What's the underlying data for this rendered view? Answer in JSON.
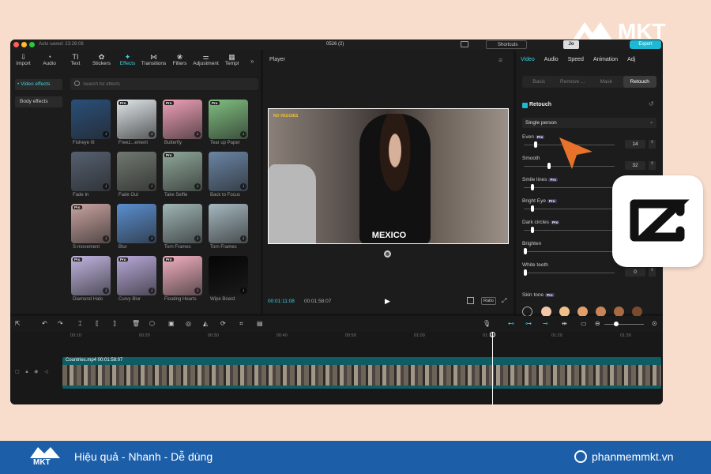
{
  "titlebar": {
    "autosave": "Auto saved: 23:28:08",
    "project": "0526 (2)",
    "shortcuts": "Shortcuts",
    "user": "Jo",
    "export": "Export"
  },
  "left_tabs": [
    {
      "label": "Import",
      "icon": "import-icon"
    },
    {
      "label": "Audio",
      "icon": "audio-icon"
    },
    {
      "label": "Text",
      "icon": "text-icon",
      "glyph": "TI"
    },
    {
      "label": "Stickers",
      "icon": "sticker-icon"
    },
    {
      "label": "Effects",
      "icon": "effects-icon",
      "active": true
    },
    {
      "label": "Transitions",
      "icon": "transitions-icon"
    },
    {
      "label": "Filters",
      "icon": "filters-icon"
    },
    {
      "label": "Adjustment",
      "icon": "adjustment-icon"
    },
    {
      "label": "Templ",
      "icon": "template-icon"
    }
  ],
  "effects_sidebar": {
    "video": "• Video effects",
    "body": "Body effects"
  },
  "search": {
    "placeholder": "Search for effects"
  },
  "effects": [
    {
      "label": "Fisheye III",
      "pro": false,
      "color": "#2a4f7a"
    },
    {
      "label": "Freez...ement",
      "pro": true,
      "color": "#dfe5e8"
    },
    {
      "label": "Butterfly",
      "pro": true,
      "color": "#f0a0b8"
    },
    {
      "label": "Tear up Paper",
      "pro": true,
      "color": "#7fbf7f"
    },
    {
      "label": "Fade In",
      "pro": false,
      "color": "#556070"
    },
    {
      "label": "Fade Out",
      "pro": false,
      "color": "#707870"
    },
    {
      "label": "Take Selfie",
      "pro": true,
      "color": "#8fa89a"
    },
    {
      "label": "Back to Focus",
      "pro": false,
      "color": "#6a85a5"
    },
    {
      "label": "S-movement",
      "pro": true,
      "color": "#c9a3a0"
    },
    {
      "label": "Blur",
      "pro": false,
      "color": "#5a8fd0"
    },
    {
      "label": "Torn Frames",
      "pro": false,
      "color": "#9fb5b5"
    },
    {
      "label": "Torn Frames",
      "pro": false,
      "color": "#a5b8c0"
    },
    {
      "label": "Diamond Halo",
      "pro": true,
      "color": "#c0b5e0"
    },
    {
      "label": "Curvy Blur",
      "pro": true,
      "color": "#b8a8d8"
    },
    {
      "label": "Floating Hearts",
      "pro": true,
      "color": "#f2b0c0"
    },
    {
      "label": "Wipe Board",
      "pro": false,
      "color": "#050505"
    }
  ],
  "player": {
    "title": "Player",
    "overlay_tag": "NO VEGGIES",
    "caption": "MEXICO",
    "current": "00:01:11:08",
    "total": "00:01:58:07",
    "ratio": "Ratio"
  },
  "right_tabs": [
    "Video",
    "Audio",
    "Speed",
    "Animation",
    "Adj"
  ],
  "subtabs": [
    "Basic",
    "Remove ...",
    "Mask",
    "Retouch"
  ],
  "retouch": {
    "title": "Retouch",
    "mode": "Single person",
    "sliders": [
      {
        "label": "Even",
        "pro": true,
        "value": 14,
        "level": 0.14,
        "show_num": true
      },
      {
        "label": "Smooth",
        "pro": false,
        "value": 32,
        "level": 0.32,
        "show_num": true
      },
      {
        "label": "Smile lines",
        "pro": true,
        "level": 0.1
      },
      {
        "label": "Bright Eye",
        "pro": true,
        "level": 0.1
      },
      {
        "label": "Dark circles",
        "pro": true,
        "level": 0.1
      },
      {
        "label": "Brighten",
        "pro": false,
        "level": 0
      },
      {
        "label": "White teeth",
        "pro": false,
        "level": 0,
        "value": 0
      }
    ],
    "skin_tone": "Skin tone",
    "skin_colors": [
      "#f2c6a6",
      "#f0c08a",
      "#e0a06a",
      "#c88656",
      "#a86a42",
      "#7a4a2e"
    ]
  },
  "timeline": {
    "ticks": [
      "00:10",
      "00:20",
      "00:30",
      "00:40",
      "00:50",
      "01:00",
      "01:10",
      "01:20",
      "01:30"
    ],
    "clip": "Countries.mp4  00:01:58:07"
  },
  "brand": {
    "name": "MKT",
    "tagline": "Hiệu quả - Nhanh - Dễ dùng",
    "site": "phanmemmkt.vn",
    "accent": "#e8722a"
  }
}
